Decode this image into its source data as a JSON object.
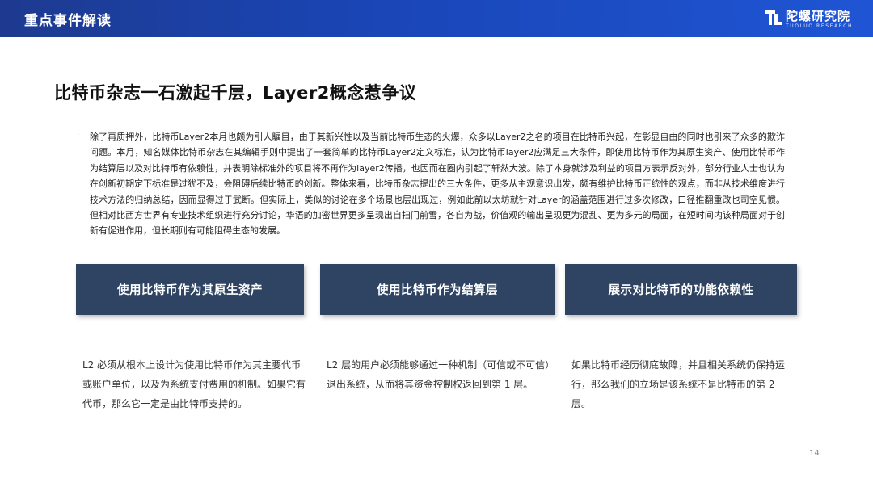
{
  "header": {
    "title": "重点事件解读",
    "logo_text": "陀螺研究院",
    "logo_subtitle": "TUOLUO RESEARCH",
    "logo_icon": "tl-logo-icon",
    "bar_color": "#1f4fc4"
  },
  "headline": "比特币杂志一石激起千层，Layer2概念惹争议",
  "bullet": "·",
  "paragraph": "除了再质押外，比特币Layer2本月也颇为引人瞩目，由于其新兴性以及当前比特币生态的火爆，众多以Layer2之名的项目在比特币兴起，在彰显自由的同时也引来了众多的欺诈问题。本月，知名媒体比特币杂志在其编辑手则中提出了一套简单的比特币Layer2定义标准，认为比特币layer2应满足三大条件，即使用比特币作为其原生资产、使用比特币作为结算层以及对比特币有依赖性，并表明除标准外的项目将不再作为layer2传播，也因而在圈内引起了轩然大波。除了本身就涉及利益的项目方表示反对外，部分行业人士也认为在创新初期定下标准是过犹不及，会阻碍后续比特币的创新。整体来看，比特币杂志提出的三大条件，更多从主观意识出发，颇有维护比特币正统性的观点，而非从技术维度进行技术方法的归纳总结，因而显得过于武断。但实际上，类似的讨论在多个场景也层出现过，例如此前以太坊就针对Layer的涵盖范围进行过多次修改，口径推翻重改也司空见惯。但相对比西方世界有专业技术组织进行充分讨论，华语的加密世界更多呈现出自扫门前雪，各自为战，价值观的输出呈现更为混乱、更为多元的局面，在短时间内该种局面对于创新有促进作用，但长期则有可能阻碍生态的发展。",
  "cards": [
    {
      "title": "使用比特币作为其原生资产",
      "body": "L2 必须从根本上设计为使用比特币作为其主要代币或账户单位，以及为系统支付费用的机制。如果它有代币，那么它一定是由比特币支持的。"
    },
    {
      "title": "使用比特币作为结算层",
      "body": "L2 层的用户必须能够通过一种机制（可信或不可信）退出系统，从而将其资金控制权返回到第 1 层。"
    },
    {
      "title": "展示对比特币的功能依赖性",
      "body": "如果比特币经历彻底故障，并且相关系统仍保持运行，那么我们的立场是该系统不是比特币的第 2 层。"
    }
  ],
  "card_color": "#2e4462",
  "page_number": "14"
}
